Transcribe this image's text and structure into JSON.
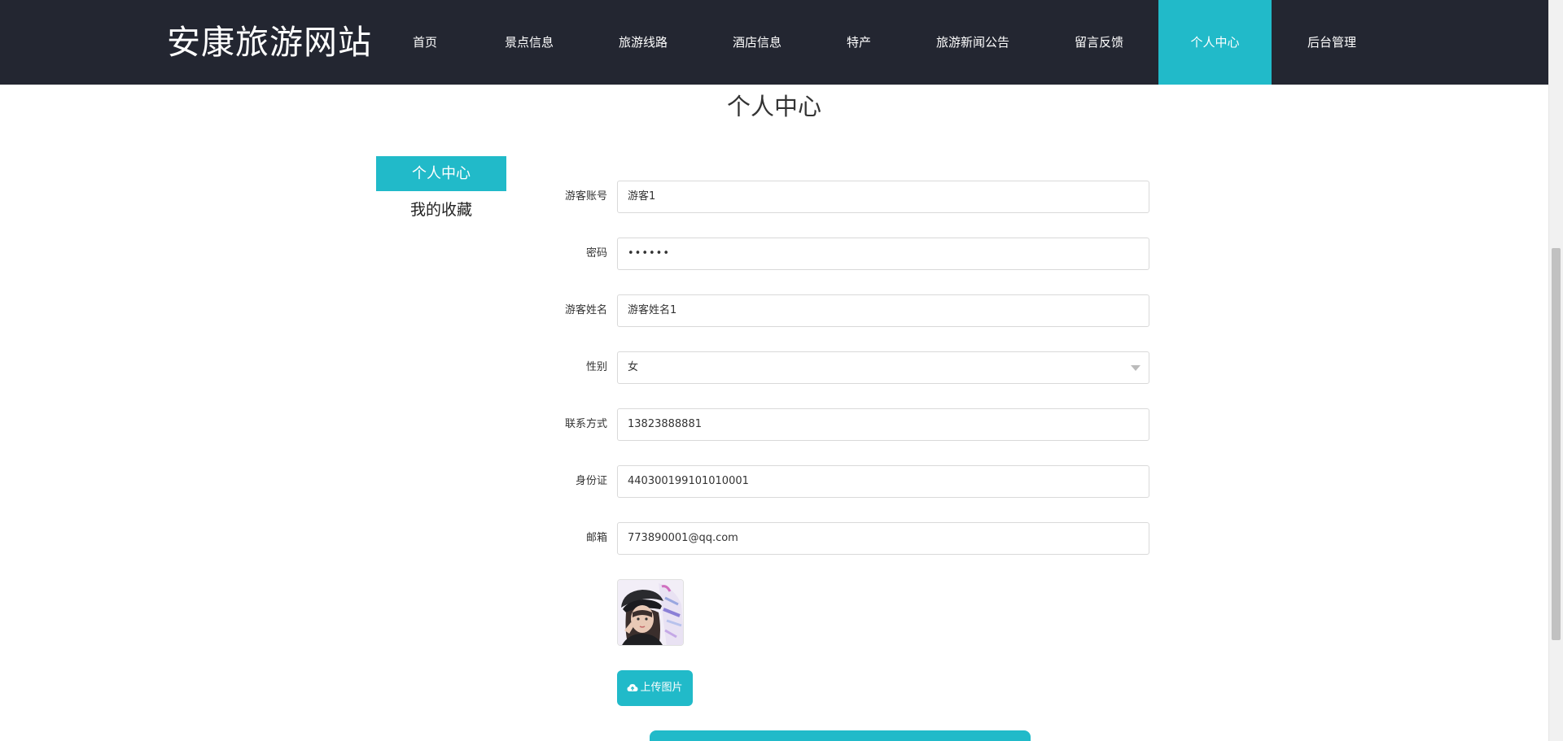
{
  "header": {
    "site_title": "安康旅游网站",
    "nav": [
      {
        "label": "首页"
      },
      {
        "label": "景点信息"
      },
      {
        "label": "旅游线路"
      },
      {
        "label": "酒店信息"
      },
      {
        "label": "特产"
      },
      {
        "label": "旅游新闻公告"
      },
      {
        "label": "留言反馈"
      },
      {
        "label": "个人中心",
        "active": true
      },
      {
        "label": "后台管理"
      }
    ],
    "accent_color": "#21bac9",
    "background_color": "#232631"
  },
  "page_title": "个人中心",
  "sidebar": {
    "items": [
      {
        "label": "个人中心",
        "active": true
      },
      {
        "label": "我的收藏"
      }
    ]
  },
  "form": {
    "fields": [
      {
        "label": "游客账号",
        "value": "游客1"
      },
      {
        "label": "密码",
        "value": "••••••"
      },
      {
        "label": "游客姓名",
        "value": "游客姓名1"
      },
      {
        "label": "性别",
        "value": "女"
      },
      {
        "label": "联系方式",
        "value": "13823888881"
      },
      {
        "label": "身份证",
        "value": "440300199101010001"
      },
      {
        "label": "邮箱",
        "value": "773890001@qq.com"
      }
    ],
    "upload_label": "上传图片",
    "upload_icon": "cloud-upload-icon"
  }
}
